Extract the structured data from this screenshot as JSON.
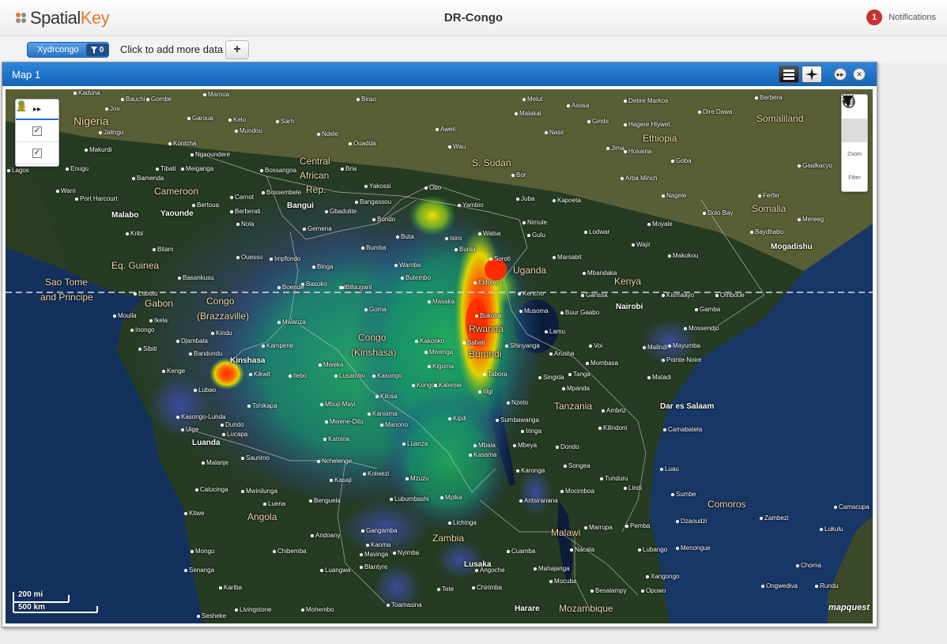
{
  "app": {
    "brand_prefix": "Spatial",
    "brand_suffix": "Key",
    "page_title": "DR-Congo"
  },
  "notifications": {
    "count": "1",
    "label": "Notifications"
  },
  "databar": {
    "dataset_name": "Xydrcongo",
    "filter_count": "0",
    "add_text": "Click to add more data",
    "add_button": "+"
  },
  "panel": {
    "title": "Map 1"
  },
  "layers": {
    "toggle": "▸▸"
  },
  "tools": {
    "zoom_label": "Zoom",
    "filter_label": "Filter"
  },
  "scale": {
    "miles": "200 mi",
    "km": "500 km"
  },
  "attribution": "mapquest",
  "colors": {
    "header_blue": "#1f6fd0",
    "notif_red": "#c8312f"
  },
  "map_labels": {
    "countries": [
      "Nigeria",
      "Central",
      "African",
      "Rep.",
      "S. Sudan",
      "Ethiopia",
      "Somaliland",
      "Cameroon",
      "Eq. Guinea",
      "Sao Tome",
      "and Principe",
      "Gabon",
      "Congo",
      "(Brazzaville)",
      "Congo",
      "(Kinshasa)",
      "Uganda",
      "Kenya",
      "Somalia",
      "Rwanda",
      "Burundi",
      "Tanzania",
      "Angola",
      "Zambia",
      "Malawi",
      "Mozambique",
      "Comoros"
    ],
    "capitals": [
      "Bangui",
      "Malabo",
      "Yaounde",
      "Kinshasa",
      "Luanda",
      "Nairobi",
      "Mogadishu",
      "Dar es Salaam",
      "Lusaka",
      "Harare"
    ],
    "cities": [
      "Kaduna",
      "Bauchi",
      "Gombe",
      "Jos",
      "Maroua",
      "Garoua",
      "Kelo",
      "Sarh",
      "Birao",
      "Melut",
      "Asosa",
      "Debre Markos",
      "Dire Dawa",
      "Berbera",
      "Malakal",
      "Gimbi",
      "Hagere Hiywet",
      "Jalingo",
      "Mundou",
      "Ndele",
      "Aweil",
      "Nasir",
      "Wau",
      "Jima",
      "Hosaina",
      "Goba",
      "Kontcha",
      "Ngaoundere",
      "Ouadda",
      "Bor",
      "Arba Minch",
      "Gaalkacyo",
      "Makurdi",
      "Enugu",
      "Bamenda",
      "Meiganga",
      "Tibati",
      "Bossangoa",
      "Bria",
      "Yakossi",
      "Obo",
      "Yambio",
      "Juba",
      "Kapoeta",
      "Ferfer",
      "Warri",
      "Port Harcourt",
      "Carnot",
      "Bossembele",
      "Berberati",
      "Gbadolite",
      "Bangassou",
      "Nimule",
      "Nagele",
      "Dolo Bay",
      "Lagos",
      "Kribi",
      "Bertoua",
      "Nola",
      "Gemena",
      "Bondo",
      "Buta",
      "Isiro",
      "Watsa",
      "Gulu",
      "Lodwar",
      "Moyale",
      "Baydhabo",
      "Mereeg",
      "Bitam",
      "Ouesso",
      "Impfondo",
      "Binga",
      "Bumba",
      "Wamba",
      "Bunia",
      "Soroti",
      "Marsabit",
      "Wajir",
      "Makokou",
      "Basankusu",
      "Basoko",
      "Kisangani",
      "Butembo",
      "Eldoret",
      "Mbandaka",
      "Boende",
      "Bifoun",
      "Lubutu",
      "Masaka",
      "Kericho",
      "Garissa",
      "Kismaayo",
      "Omboue",
      "Mouila",
      "Ikela",
      "Goma",
      "Bukoba",
      "Musoma",
      "Buur Gaabo",
      "Gamba",
      "Inongo",
      "Mwanza",
      "Lamu",
      "Mossendjo",
      "Djambala",
      "Kindu",
      "Kakonko",
      "Shinyanga",
      "Arusha",
      "Voi",
      "Malindi",
      "Mayumba",
      "Sibiti",
      "Bandundu",
      "Kampene",
      "Mwenga",
      "Babati",
      "Mombasa",
      "Pointe-Noire",
      "Kenge",
      "Kikwit",
      "Ilebo",
      "Mweka",
      "Lusambo",
      "Kasongo",
      "Kigoma",
      "Tabora",
      "Singida",
      "Tanga",
      "Matadi",
      "Lubao",
      "Kongolo",
      "Kalemie",
      "Itigi",
      "Mpanda",
      "Nzeto",
      "Kasongo-Lunda",
      "Tshikapa",
      "Mbuji-Mayi",
      "Kilosa",
      "Ambriz",
      "Uige",
      "Dundo",
      "Mwene-Ditu",
      "Kaniama",
      "Manono",
      "Kipili",
      "Sumbawanga",
      "Iringa",
      "Kilindoni",
      "Camabatela",
      "Lucapa",
      "Kamina",
      "Luanza",
      "Mbala",
      "Mbeya",
      "Dondo",
      "Malanje",
      "Saurimo",
      "Nchelenge",
      "Kasama",
      "Karonga",
      "Songea",
      "Tunduru",
      "Lindi",
      "Luau",
      "Kasaji",
      "Kolwezi",
      "Mzuzu",
      "Mocimboa",
      "Sumbe",
      "Calucinga",
      "Mwinilunga",
      "Lubumbashi",
      "Mpika",
      "Antsiranana",
      "Camacupa",
      "Luena",
      "Benguela",
      "Kitwe",
      "Lichinga",
      "Marrupa",
      "Pemba",
      "Dzaoudzi",
      "Zambezi",
      "Gangamba",
      "Andoany",
      "Lukulu",
      "Kaoma",
      "Nyimba",
      "Cuamba",
      "Nacala",
      "Lubango",
      "Menongue",
      "Mongu",
      "Chibemba",
      "Mavinga",
      "Senanga",
      "Luangwa",
      "Blantyre",
      "Angoche",
      "Mahajanga",
      "Xangongo",
      "Choma",
      "Kariba",
      "Tete",
      "Chirimba",
      "Mocuba",
      "Besalampy",
      "Opuwo",
      "Ongwediva",
      "Rundu",
      "Sesheke",
      "Livingstone",
      "Mohembo",
      "Toamasina"
    ]
  }
}
